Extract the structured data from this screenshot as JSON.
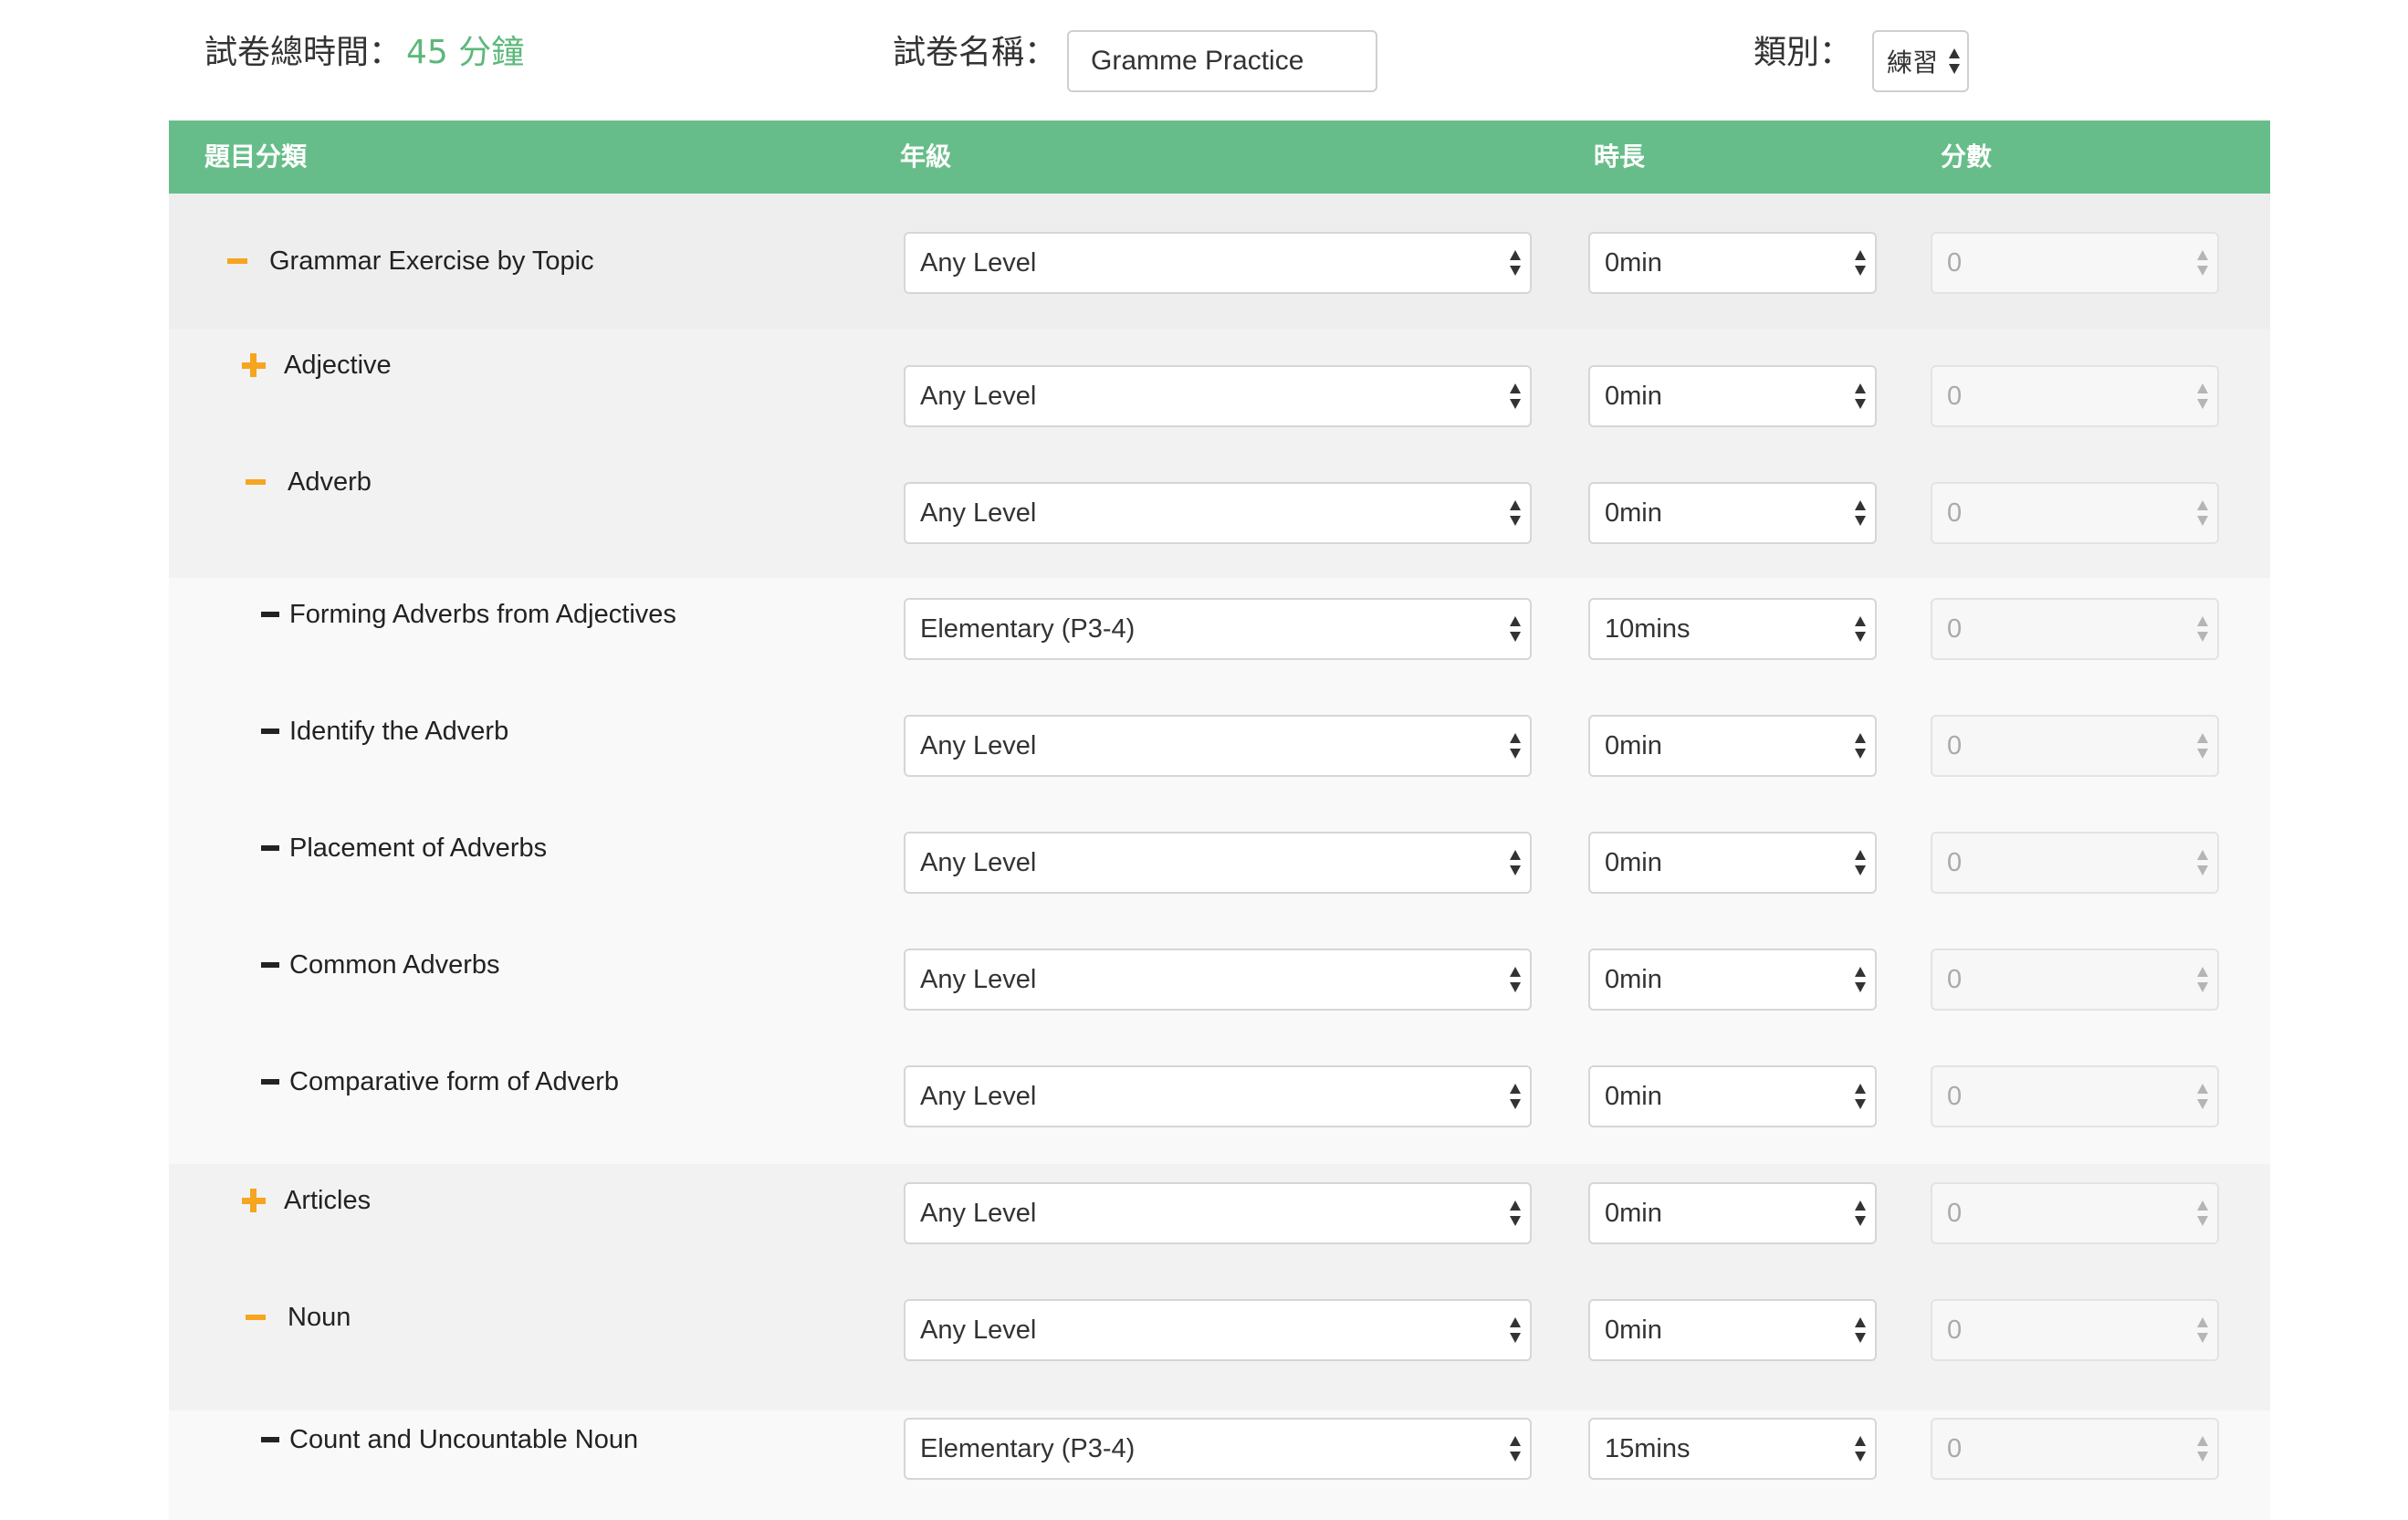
{
  "header": {
    "total_time_label": "試卷總時間：",
    "total_time_value": "45 分鐘",
    "total_time_color": "#5cb87a",
    "paper_name_label": "試卷名稱：",
    "paper_name_value": "Gramme Practice",
    "category_label": "類別：",
    "category_value": "練習"
  },
  "table": {
    "header_color": "#67bd89",
    "columns": [
      "題目分類",
      "年級",
      "時長",
      "分數"
    ],
    "rows": [
      {
        "title": "Grammar Exercise by Topic",
        "toggle": "minus",
        "level": "Any Level",
        "duration": "0min",
        "score": "0"
      },
      {
        "title": "Adjective",
        "toggle": "plus",
        "level": "Any Level",
        "duration": "0min",
        "score": "0"
      },
      {
        "title": "Adverb",
        "toggle": "minus",
        "level": "Any Level",
        "duration": "0min",
        "score": "0"
      },
      {
        "title": "Forming Adverbs from Adjectives",
        "toggle": "dash",
        "level": "Elementary (P3-4)",
        "duration": "10mins",
        "score": "0"
      },
      {
        "title": "Identify the Adverb",
        "toggle": "dash",
        "level": "Any Level",
        "duration": "0min",
        "score": "0"
      },
      {
        "title": "Placement of Adverbs",
        "toggle": "dash",
        "level": "Any Level",
        "duration": "0min",
        "score": "0"
      },
      {
        "title": "Common Adverbs",
        "toggle": "dash",
        "level": "Any Level",
        "duration": "0min",
        "score": "0"
      },
      {
        "title": "Comparative form of Adverb",
        "toggle": "dash",
        "level": "Any Level",
        "duration": "0min",
        "score": "0"
      },
      {
        "title": "Articles",
        "toggle": "plus",
        "level": "Any Level",
        "duration": "0min",
        "score": "0"
      },
      {
        "title": "Noun",
        "toggle": "minus",
        "level": "Any Level",
        "duration": "0min",
        "score": "0"
      },
      {
        "title": "Count and Uncountable Noun",
        "toggle": "dash",
        "level": "Elementary (P3-4)",
        "duration": "15mins",
        "score": "0"
      }
    ]
  }
}
